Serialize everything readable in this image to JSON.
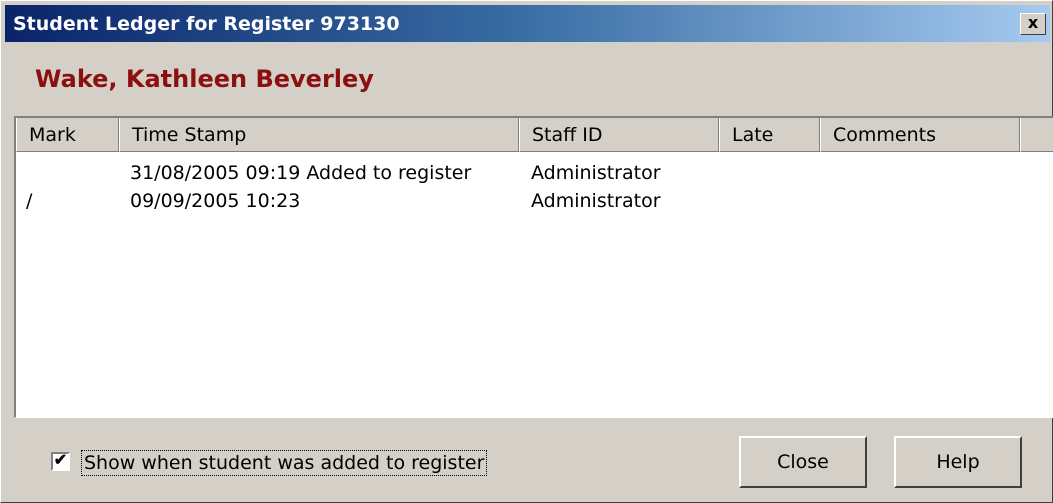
{
  "window": {
    "title": "Student Ledger for Register 973130",
    "close_glyph": "x"
  },
  "student": {
    "name": "Wake, Kathleen Beverley"
  },
  "ledger": {
    "columns": [
      "Mark",
      "Time Stamp",
      "Staff ID",
      "Late",
      "Comments"
    ],
    "rows": [
      {
        "mark": "",
        "time_stamp": "31/08/2005 09:19 Added to register",
        "staff_id": "Administrator",
        "late": "",
        "comments": ""
      },
      {
        "mark": "/",
        "time_stamp": "09/09/2005 10:23",
        "staff_id": "Administrator",
        "late": "",
        "comments": ""
      }
    ]
  },
  "footer": {
    "checkbox_label": "Show when student was added to register",
    "checkbox_checked": true,
    "checkbox_glyph": "✔",
    "close_label": "Close",
    "help_label": "Help"
  }
}
